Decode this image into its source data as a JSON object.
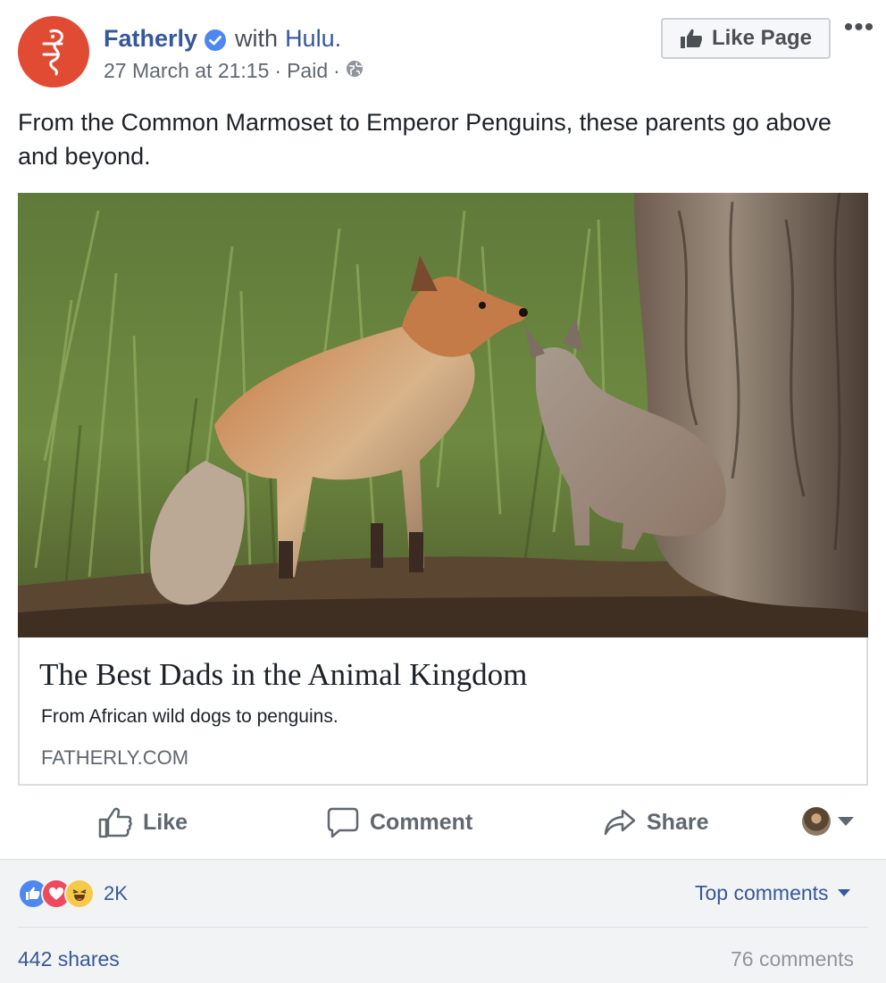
{
  "post": {
    "page_name": "Fatherly",
    "with_text": "with",
    "with_page": "Hulu.",
    "date": "27 March at 21:15",
    "sponsored": "Paid",
    "like_page_label": "Like Page",
    "more_label": "•••",
    "text": "From the Common Marmoset to Emperor Penguins, these parents go above and beyond.",
    "brand_color": "#e24b33",
    "link_color": "#365899"
  },
  "link_preview": {
    "image_icon": "fox-photo",
    "title": "The Best Dads in the Animal Kingdom",
    "description": "From African wild dogs to penguins.",
    "domain": "FATHERLY.COM"
  },
  "actions": {
    "like": "Like",
    "comment": "Comment",
    "share": "Share"
  },
  "footer": {
    "reaction_icons": [
      "like-reaction-icon",
      "love-reaction-icon",
      "haha-reaction-icon"
    ],
    "reaction_count": "2K",
    "top_comments": "Top comments",
    "shares": "442 shares",
    "comments": "76 comments"
  }
}
